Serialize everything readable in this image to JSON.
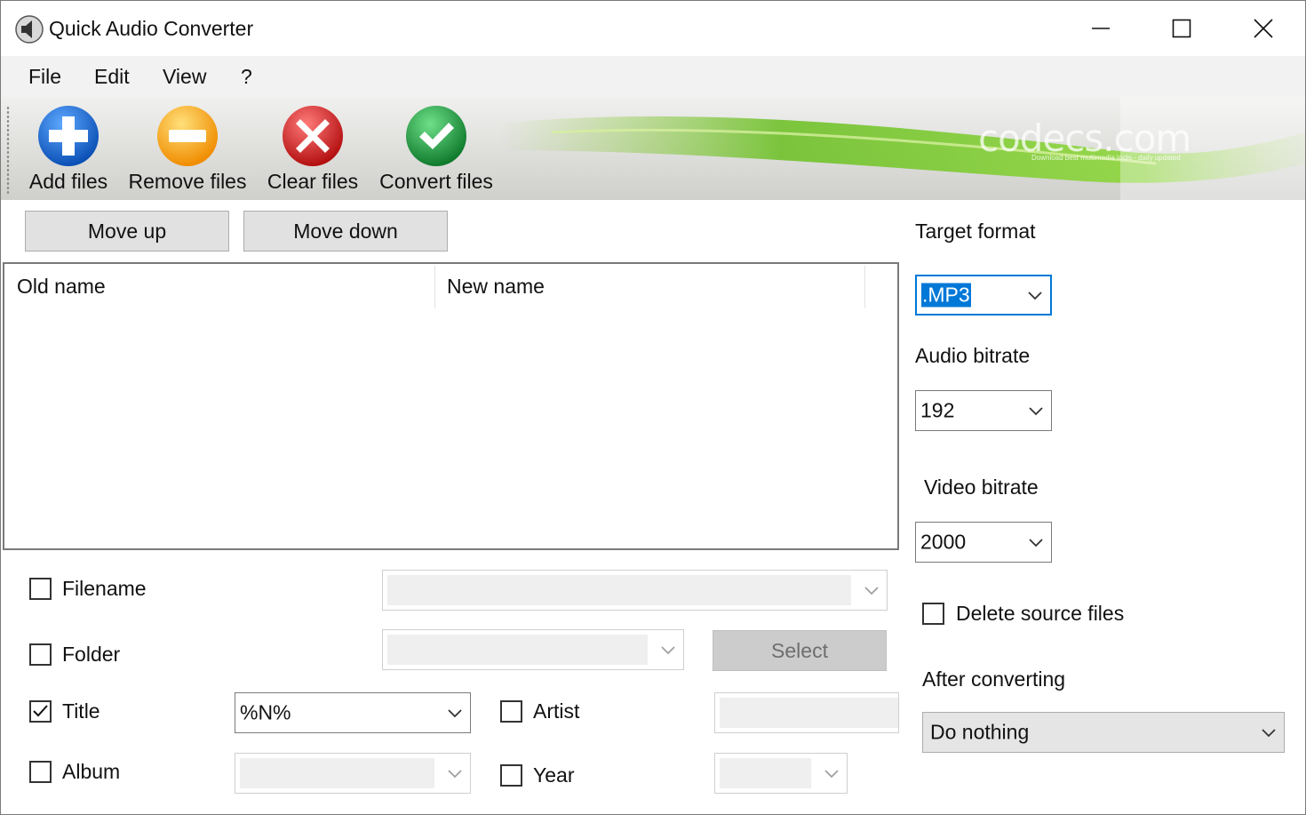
{
  "window": {
    "title": "Quick Audio Converter",
    "icon": "speaker-icon",
    "controls": [
      "minimize-icon",
      "maximize-icon",
      "close-icon"
    ]
  },
  "menu": [
    "File",
    "Edit",
    "View",
    "?"
  ],
  "toolbar": {
    "add": "Add files",
    "remove": "Remove files",
    "clear": "Clear files",
    "convert": "Convert files",
    "brand": "codecs.com",
    "brand_sub": "Download best multimedia tools - daily updated",
    "icons": [
      "add-icon",
      "remove-icon",
      "clear-icon",
      "convert-icon"
    ],
    "colors": {
      "add": "#1e6fd9",
      "remove": "#f5a623",
      "clear": "#d62b2b",
      "convert": "#22a043"
    }
  },
  "buttons": {
    "move_up": "Move up",
    "move_down": "Move down",
    "select": "Select"
  },
  "file_list": {
    "columns": [
      "Old name",
      "New name"
    ],
    "rows": []
  },
  "tags": {
    "filename": {
      "label": "Filename",
      "checked": false,
      "value": ""
    },
    "folder": {
      "label": "Folder",
      "checked": false,
      "value": ""
    },
    "title": {
      "label": "Title",
      "checked": true,
      "value": "%N%"
    },
    "artist": {
      "label": "Artist",
      "checked": false,
      "value": ""
    },
    "album": {
      "label": "Album",
      "checked": false,
      "value": ""
    },
    "year": {
      "label": "Year",
      "checked": false,
      "value": ""
    }
  },
  "settings": {
    "target_format_label": "Target format",
    "target_format": ".MP3",
    "audio_bitrate_label": "Audio bitrate",
    "audio_bitrate": "192",
    "video_bitrate_label": "Video bitrate",
    "video_bitrate": "2000",
    "delete_source_label": "Delete source files",
    "delete_source_checked": false,
    "after_converting_label": "After converting",
    "after_converting": "Do nothing"
  }
}
